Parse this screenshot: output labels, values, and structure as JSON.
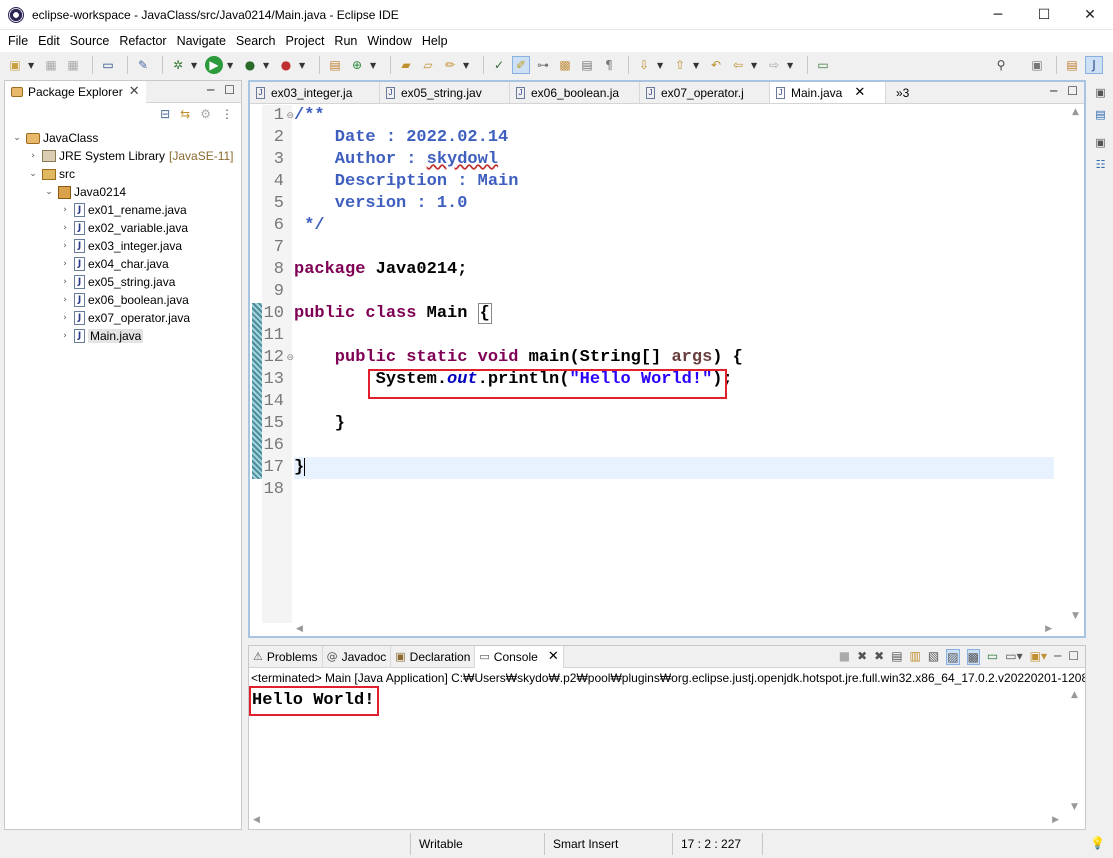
{
  "window": {
    "title": "eclipse-workspace - JavaClass/src/Java0214/Main.java - Eclipse IDE",
    "minimize": "─",
    "maximize": "☐",
    "close": "✕"
  },
  "menu": [
    "File",
    "Edit",
    "Source",
    "Refactor",
    "Navigate",
    "Search",
    "Project",
    "Run",
    "Window",
    "Help"
  ],
  "package_explorer": {
    "tab_label": "Package Explorer",
    "tree": [
      {
        "label": "JavaClass",
        "type": "project",
        "expanded": true
      },
      {
        "label": "JRE System Library",
        "tag": "[JavaSE-11]",
        "type": "library",
        "expanded": false
      },
      {
        "label": "src",
        "type": "source-folder",
        "expanded": true
      },
      {
        "label": "Java0214",
        "type": "package",
        "expanded": true
      },
      {
        "label": "ex01_rename.java",
        "type": "java-file"
      },
      {
        "label": "ex02_variable.java",
        "type": "java-file"
      },
      {
        "label": "ex03_integer.java",
        "type": "java-file"
      },
      {
        "label": "ex04_char.java",
        "type": "java-file"
      },
      {
        "label": "ex05_string.java",
        "type": "java-file"
      },
      {
        "label": "ex06_boolean.java",
        "type": "java-file"
      },
      {
        "label": "ex07_operator.java",
        "type": "java-file"
      },
      {
        "label": "Main.java",
        "type": "java-file",
        "selected": true
      }
    ]
  },
  "editor": {
    "tabs": [
      "ex03_integer.ja",
      "ex05_string.jav",
      "ex06_boolean.ja",
      "ex07_operator.j",
      "Main.java"
    ],
    "active_tab": "Main.java",
    "overflow": "»3",
    "line_numbers": [
      "1",
      "2",
      "3",
      "4",
      "5",
      "6",
      "7",
      "8",
      "9",
      "10",
      "11",
      "12",
      "13",
      "14",
      "15",
      "16",
      "17",
      "18"
    ],
    "code": {
      "l1": "/**",
      "l2": "    Date : 2022.02.14",
      "l3a": "    Author : ",
      "l3b": "skydowl",
      "l4": "    Description : Main",
      "l5": "    version : 1.0",
      "l6": " */",
      "l8a": "package",
      "l8b": " Java0214;",
      "l10a": "public class",
      "l10b": " Main ",
      "l10c": "{",
      "l12a": "    public static void",
      "l12b": " main(String[] ",
      "l12c": "args",
      "l12d": ") {",
      "l13a": "        System.",
      "l13b": "out",
      "l13c": ".println(",
      "l13d": "\"Hello World!\"",
      "l13e": ");",
      "l15": "    }",
      "l17": "}"
    }
  },
  "console": {
    "tabs": [
      {
        "label": "Problems",
        "icon": "problems-icon"
      },
      {
        "label": "Javadoc",
        "icon": "javadoc-icon"
      },
      {
        "label": "Declaration",
        "icon": "declaration-icon"
      },
      {
        "label": "Console",
        "icon": "console-icon"
      }
    ],
    "terminated": "<terminated> Main [Java Application] C:₩Users₩skydo₩.p2₩pool₩plugins₩org.eclipse.justj.openjdk.hotspot.jre.full.win32.x86_64_17.0.2.v20220201-1208",
    "output": "Hello World!"
  },
  "status": {
    "mode": "Writable",
    "insert": "Smart Insert",
    "position": "17 : 2 : 227"
  },
  "colors": {
    "keyword": "#7f0055",
    "javadoc": "#3f5fbf",
    "string": "#2a00ff",
    "field": "#0000c0",
    "highlight_box": "#e0202c"
  }
}
